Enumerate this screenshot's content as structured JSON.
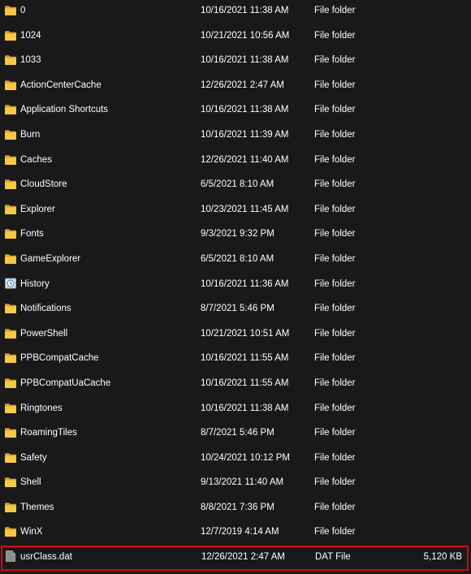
{
  "files": [
    {
      "name": "0",
      "date": "10/16/2021 11:38 AM",
      "type": "File folder",
      "size": "",
      "icon": "folder-icon"
    },
    {
      "name": "1024",
      "date": "10/21/2021 10:56 AM",
      "type": "File folder",
      "size": "",
      "icon": "folder-icon"
    },
    {
      "name": "1033",
      "date": "10/16/2021 11:38 AM",
      "type": "File folder",
      "size": "",
      "icon": "folder-icon"
    },
    {
      "name": "ActionCenterCache",
      "date": "12/26/2021 2:47 AM",
      "type": "File folder",
      "size": "",
      "icon": "folder-icon"
    },
    {
      "name": "Application Shortcuts",
      "date": "10/16/2021 11:38 AM",
      "type": "File folder",
      "size": "",
      "icon": "folder-icon"
    },
    {
      "name": "Burn",
      "date": "10/16/2021 11:39 AM",
      "type": "File folder",
      "size": "",
      "icon": "folder-icon"
    },
    {
      "name": "Caches",
      "date": "12/26/2021 11:40 AM",
      "type": "File folder",
      "size": "",
      "icon": "folder-icon"
    },
    {
      "name": "CloudStore",
      "date": "6/5/2021 8:10 AM",
      "type": "File folder",
      "size": "",
      "icon": "folder-icon"
    },
    {
      "name": "Explorer",
      "date": "10/23/2021 11:45 AM",
      "type": "File folder",
      "size": "",
      "icon": "folder-icon"
    },
    {
      "name": "Fonts",
      "date": "9/3/2021 9:32 PM",
      "type": "File folder",
      "size": "",
      "icon": "folder-icon"
    },
    {
      "name": "GameExplorer",
      "date": "6/5/2021 8:10 AM",
      "type": "File folder",
      "size": "",
      "icon": "folder-icon"
    },
    {
      "name": "History",
      "date": "10/16/2021 11:36 AM",
      "type": "File folder",
      "size": "",
      "icon": "history-folder-icon"
    },
    {
      "name": "Notifications",
      "date": "8/7/2021 5:46 PM",
      "type": "File folder",
      "size": "",
      "icon": "folder-icon"
    },
    {
      "name": "PowerShell",
      "date": "10/21/2021 10:51 AM",
      "type": "File folder",
      "size": "",
      "icon": "folder-icon"
    },
    {
      "name": "PPBCompatCache",
      "date": "10/16/2021 11:55 AM",
      "type": "File folder",
      "size": "",
      "icon": "folder-icon"
    },
    {
      "name": "PPBCompatUaCache",
      "date": "10/16/2021 11:55 AM",
      "type": "File folder",
      "size": "",
      "icon": "folder-icon"
    },
    {
      "name": "Ringtones",
      "date": "10/16/2021 11:38 AM",
      "type": "File folder",
      "size": "",
      "icon": "folder-icon"
    },
    {
      "name": "RoamingTiles",
      "date": "8/7/2021 5:46 PM",
      "type": "File folder",
      "size": "",
      "icon": "folder-icon"
    },
    {
      "name": "Safety",
      "date": "10/24/2021 10:12 PM",
      "type": "File folder",
      "size": "",
      "icon": "folder-icon"
    },
    {
      "name": "Shell",
      "date": "9/13/2021 11:40 AM",
      "type": "File folder",
      "size": "",
      "icon": "folder-icon"
    },
    {
      "name": "Themes",
      "date": "8/8/2021 7:36 PM",
      "type": "File folder",
      "size": "",
      "icon": "folder-icon"
    },
    {
      "name": "WinX",
      "date": "12/7/2019 4:14 AM",
      "type": "File folder",
      "size": "",
      "icon": "folder-icon"
    },
    {
      "name": "usrClass.dat",
      "date": "12/26/2021 2:47 AM",
      "type": "DAT File",
      "size": "5,120 KB",
      "icon": "file-icon"
    }
  ],
  "selected_file": "usrClass.dat",
  "colors": {
    "background": "#191919",
    "text": "#ffffff",
    "folder": "#f7c843",
    "folder_dark": "#d9a520",
    "file": "#8c8c8c",
    "selection_outline": "#e1000f"
  }
}
